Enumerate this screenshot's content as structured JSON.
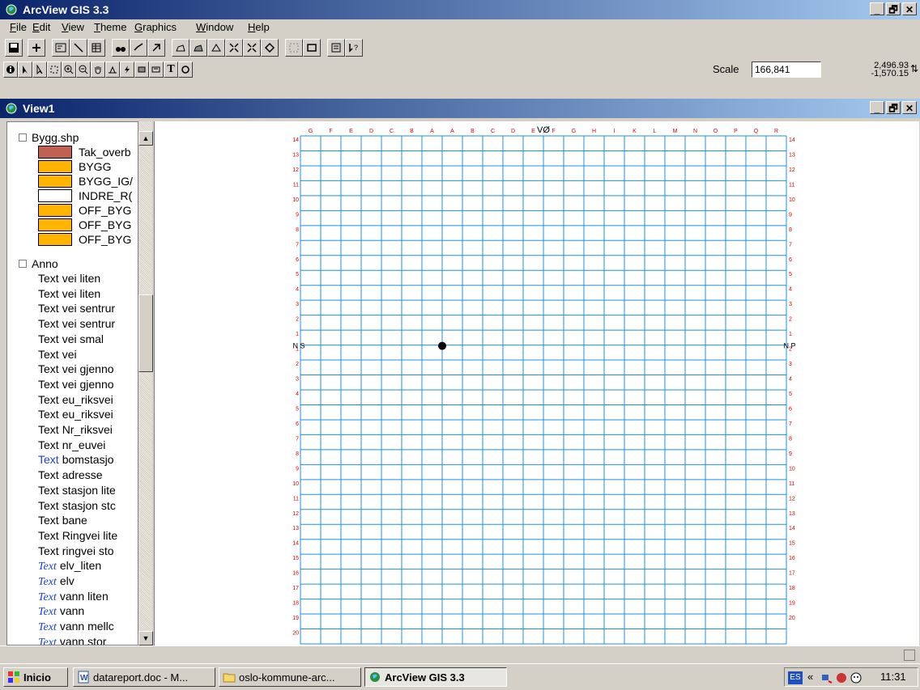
{
  "app": {
    "title": "ArcView GIS 3.3"
  },
  "window_buttons": {
    "minimize": "_",
    "restore": "🗗",
    "close": "✕"
  },
  "menu": [
    "File",
    "Edit",
    "View",
    "Theme",
    "Graphics",
    "Window",
    "Help"
  ],
  "toolbar": {
    "scale_label": "Scale",
    "scale_value": "166,841",
    "coord_x": "2,496.93",
    "coord_y": "-1,570.15"
  },
  "view": {
    "title": "View1"
  },
  "toc": {
    "theme1": {
      "name": "Bygg.shp",
      "classes": [
        {
          "label": "Tak_overb",
          "color": "#c06050"
        },
        {
          "label": "BYGG",
          "color": "#ffb400"
        },
        {
          "label": "BYGG_IG/",
          "color": "#ffb400"
        },
        {
          "label": "INDRE_R(",
          "color": "#ffffff"
        },
        {
          "label": "OFF_BYG",
          "color": "#ffb400"
        },
        {
          "label": "OFF_BYG",
          "color": "#ffb400"
        },
        {
          "label": "OFF_BYG",
          "color": "#ffb400"
        }
      ]
    },
    "theme2": {
      "name": "Anno",
      "items": [
        {
          "sym": "Text",
          "label": "vei liten",
          "style": "plain"
        },
        {
          "sym": "Text",
          "label": "vei liten",
          "style": "plain"
        },
        {
          "sym": "Text",
          "label": "vei sentrur",
          "style": "plain"
        },
        {
          "sym": "Text",
          "label": "vei sentrur",
          "style": "plain"
        },
        {
          "sym": "Text",
          "label": "vei smal",
          "style": "plain"
        },
        {
          "sym": "Text",
          "label": "vei",
          "style": "plain"
        },
        {
          "sym": "Text",
          "label": "vei gjenno",
          "style": "plain"
        },
        {
          "sym": "Text",
          "label": "vei gjenno",
          "style": "plain"
        },
        {
          "sym": "Text",
          "label": "eu_riksvei",
          "style": "plain"
        },
        {
          "sym": "Text",
          "label": "eu_riksvei",
          "style": "plain"
        },
        {
          "sym": "Text",
          "label": "Nr_riksvei",
          "style": "plain"
        },
        {
          "sym": "Text",
          "label": "nr_euvei",
          "style": "plain"
        },
        {
          "sym": "Text",
          "label": "bomstasjo",
          "style": "blue"
        },
        {
          "sym": "Text",
          "label": "adresse",
          "style": "plain"
        },
        {
          "sym": "Text",
          "label": "stasjon lite",
          "style": "plain"
        },
        {
          "sym": "Text",
          "label": "stasjon stc",
          "style": "plain"
        },
        {
          "sym": "Text",
          "label": "bane",
          "style": "plain"
        },
        {
          "sym": "Text",
          "label": "Ringvei lite",
          "style": "plain"
        },
        {
          "sym": "Text",
          "label": "ringvei sto",
          "style": "plain"
        },
        {
          "sym": "Text",
          "label": "elv_liten",
          "style": "italic"
        },
        {
          "sym": "Text",
          "label": "elv",
          "style": "italic"
        },
        {
          "sym": "Text",
          "label": "vann liten",
          "style": "italic"
        },
        {
          "sym": "Text",
          "label": "vann",
          "style": "italic"
        },
        {
          "sym": "Text",
          "label": "vann mellc",
          "style": "italic"
        },
        {
          "sym": "Text",
          "label": "vann stor",
          "style": "italic"
        }
      ]
    }
  },
  "map": {
    "center_label": "VØ",
    "top_letters": [
      "G",
      "F",
      "E",
      "D",
      "C",
      "B",
      "A",
      "A",
      "B",
      "C",
      "D",
      "E",
      "F",
      "G",
      "H",
      "I",
      "K",
      "L",
      "M",
      "N",
      "O",
      "P",
      "Q",
      "R"
    ],
    "left_numbers_top": [
      "14",
      "13",
      "12",
      "11",
      "10",
      "9",
      "8",
      "7",
      "6",
      "5",
      "4",
      "3",
      "2",
      "1"
    ],
    "left_numbers_bottom": [
      "1",
      "2",
      "3",
      "4",
      "5",
      "6",
      "7",
      "8",
      "9",
      "10",
      "11",
      "12",
      "13",
      "14",
      "15",
      "16",
      "17",
      "18",
      "19",
      "20"
    ],
    "right_numbers": [
      "14",
      "13",
      "12",
      "11",
      "10",
      "9",
      "8",
      "7",
      "6",
      "5",
      "4",
      "3",
      "2",
      "1",
      "2",
      "3",
      "4",
      "5",
      "6",
      "7",
      "8",
      "9",
      "10",
      "11",
      "12",
      "13",
      "14",
      "15",
      "16",
      "17",
      "18",
      "19",
      "20"
    ],
    "side_label_left": "N S",
    "side_label_right": "N P",
    "grid_color": "#1f8fe0",
    "label_color": "#e00000"
  },
  "taskbar": {
    "start": "Inicio",
    "items": [
      "datareport.doc - M...",
      "oslo-kommune-arc...",
      "ArcView GIS 3.3"
    ],
    "lang": "ES",
    "chevron": "«",
    "clock": "11:31"
  }
}
